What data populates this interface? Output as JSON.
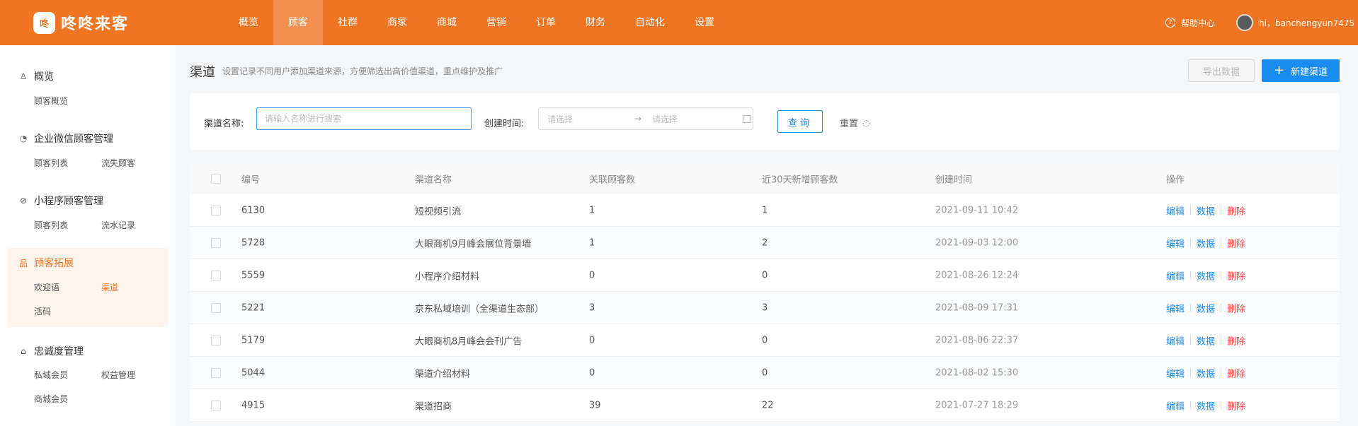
{
  "app": {
    "logo_text": "咚咚来客",
    "logo_mark": "咚"
  },
  "nav": [
    "概览",
    "顾客",
    "社群",
    "商家",
    "商城",
    "营销",
    "订单",
    "财务",
    "自动化",
    "设置"
  ],
  "nav_active_index": 1,
  "topbar": {
    "help_label": "帮助中心",
    "help_icon": "?",
    "user_label": "hi，banchengyun7475"
  },
  "sidebar": {
    "groups": [
      {
        "title": "概览",
        "icon": "user-icon",
        "items": [
          "顾客概览"
        ]
      },
      {
        "title": "企业微信顾客管理",
        "icon": "chat-icon",
        "items": [
          "顾客列表",
          "流失顾客"
        ]
      },
      {
        "title": "小程序顾客管理",
        "icon": "compass-icon",
        "items": [
          "顾客列表",
          "流水记录"
        ]
      },
      {
        "title": "顾客拓展",
        "icon": "network-icon",
        "items": [
          "欢迎语",
          "渠道",
          "活码"
        ]
      },
      {
        "title": "忠诚度管理",
        "icon": "home-icon",
        "items": [
          "私域会员",
          "权益管理",
          "商城会员"
        ]
      }
    ],
    "active_group": "顾客拓展",
    "active_item": "渠道"
  },
  "page": {
    "title": "渠道",
    "description": "设置记录不同用户添加渠道来源，方便筛选出高价值渠道，重点维护及推广",
    "export_label": "导出数据",
    "new_label": "新建渠道"
  },
  "filter": {
    "name_label": "渠道名称:",
    "name_placeholder": "请输入名称进行搜索",
    "date_label": "创建时间:",
    "date_start_placeholder": "请选择",
    "date_arrow": "→",
    "date_end_placeholder": "请选择",
    "query_label": "查询",
    "reset_label": "重置",
    "reset_icon": "◌"
  },
  "table": {
    "columns": [
      "编号",
      "渠道名称",
      "关联顾客数",
      "近30天新增顾客数",
      "创建时间",
      "操作"
    ],
    "rows": [
      {
        "id": "6130",
        "name": "短视频引流",
        "count": "1",
        "new30": "1",
        "time": "2021-09-11 10:42"
      },
      {
        "id": "5728",
        "name": "大眼商机9月峰会展位背景墙",
        "count": "1",
        "new30": "2",
        "time": "2021-09-03 12:00"
      },
      {
        "id": "5559",
        "name": "小程序介绍材料",
        "count": "0",
        "new30": "0",
        "time": "2021-08-26 12:24"
      },
      {
        "id": "5221",
        "name": "京东私域培训（全渠道生态部）",
        "count": "3",
        "new30": "3",
        "time": "2021-08-09 17:31"
      },
      {
        "id": "5179",
        "name": "大眼商机8月峰会会刊广告",
        "count": "0",
        "new30": "0",
        "time": "2021-08-06 22:37"
      },
      {
        "id": "5044",
        "name": "渠道介绍材料",
        "count": "0",
        "new30": "0",
        "time": "2021-08-02 15:30"
      },
      {
        "id": "4915",
        "name": "渠道招商",
        "count": "39",
        "new30": "22",
        "time": "2021-07-27 18:29"
      }
    ],
    "ops": {
      "edit": "编辑",
      "data": "数据",
      "delete": "删除"
    }
  },
  "colors": {
    "brand": "#f07523",
    "primary": "#1a8df0",
    "danger": "#f04a4a"
  }
}
